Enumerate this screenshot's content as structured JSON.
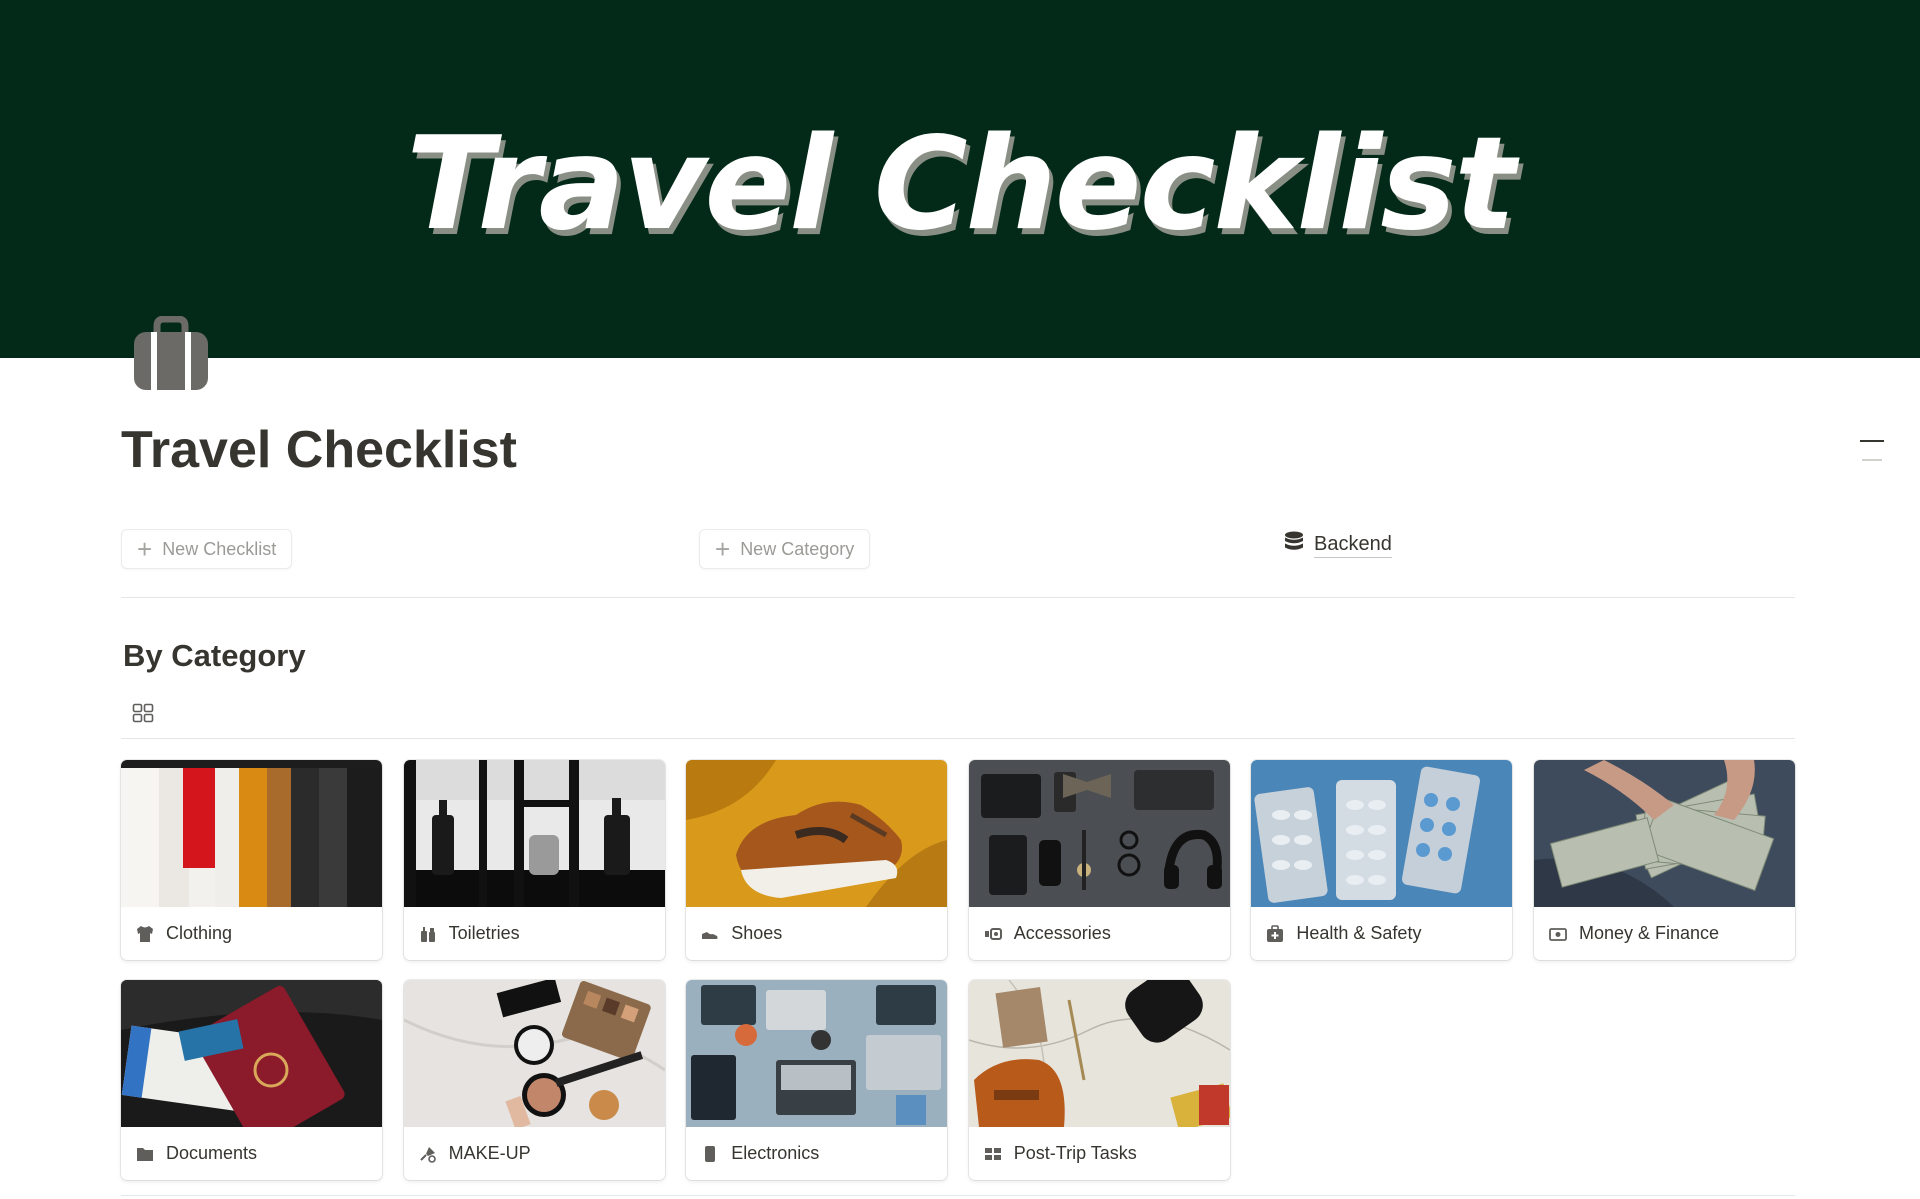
{
  "cover": {
    "text": "Travel Checklist",
    "background": "#032a18"
  },
  "page": {
    "icon": "briefcase-icon",
    "title": "Travel Checklist"
  },
  "actions": {
    "new_checklist": "New Checklist",
    "new_category": "New Category",
    "backend": "Backend",
    "backend_icon": "database-icon"
  },
  "section": {
    "heading": "By Category",
    "view_icon": "gallery-view-icon"
  },
  "categories": [
    {
      "label": "Clothing",
      "icon": "shirt-icon"
    },
    {
      "label": "Toiletries",
      "icon": "bottles-icon"
    },
    {
      "label": "Shoes",
      "icon": "shoe-icon"
    },
    {
      "label": "Accessories",
      "icon": "accessories-icon"
    },
    {
      "label": "Health & Safety",
      "icon": "first-aid-icon"
    },
    {
      "label": "Money & Finance",
      "icon": "money-icon"
    },
    {
      "label": "Documents",
      "icon": "folder-icon"
    },
    {
      "label": "MAKE-UP",
      "icon": "makeup-brush-icon"
    },
    {
      "label": "Electronics",
      "icon": "phone-icon"
    },
    {
      "label": "Post-Trip Tasks",
      "icon": "layout-icon"
    }
  ]
}
